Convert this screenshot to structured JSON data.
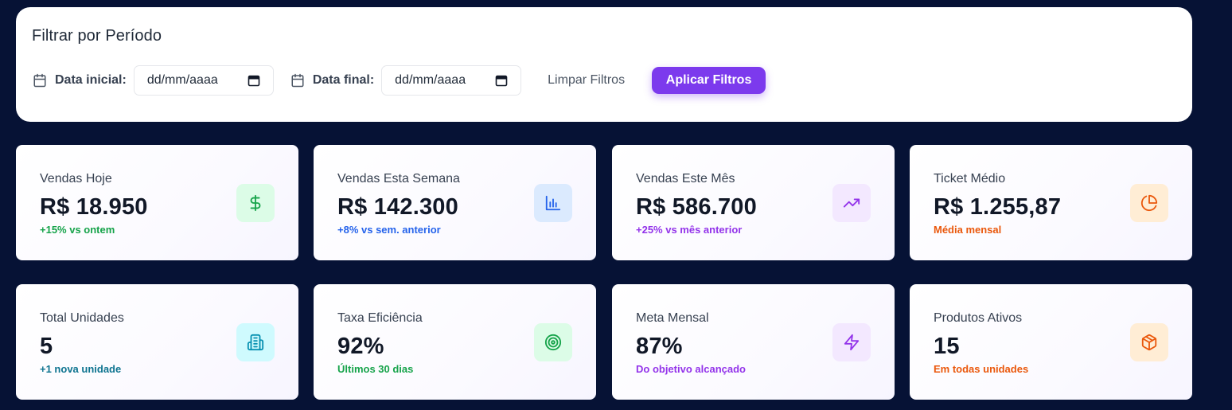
{
  "filter": {
    "title": "Filtrar por Período",
    "start_label": "Data inicial:",
    "start_placeholder": "dd/mm/aaaa",
    "end_label": "Data final:",
    "end_placeholder": "dd/mm/aaaa",
    "clear_label": "Limpar Filtros",
    "apply_label": "Aplicar Filtros"
  },
  "colors": {
    "accent": "#7c3aed",
    "background": "#061235",
    "green": "#16a34a",
    "blue": "#2563eb",
    "purple": "#9333ea",
    "orange": "#ea580c",
    "cyan": "#0e7490"
  },
  "cards": [
    {
      "label": "Vendas Hoje",
      "value": "R$ 18.950",
      "sub": "+15% vs ontem",
      "icon": "dollar-icon",
      "tone": "green"
    },
    {
      "label": "Vendas Esta Semana",
      "value": "R$ 142.300",
      "sub": "+8% vs sem. anterior",
      "icon": "bar-chart-icon",
      "tone": "blue"
    },
    {
      "label": "Vendas Este Mês",
      "value": "R$ 586.700",
      "sub": "+25% vs mês anterior",
      "icon": "trending-up-icon",
      "tone": "purple"
    },
    {
      "label": "Ticket Médio",
      "value": "R$ 1.255,87",
      "sub": "Média mensal",
      "icon": "pie-chart-icon",
      "tone": "orange"
    },
    {
      "label": "Total Unidades",
      "value": "5",
      "sub": "+1 nova unidade",
      "icon": "building-icon",
      "tone": "cyan"
    },
    {
      "label": "Taxa Eficiência",
      "value": "92%",
      "sub": "Últimos 30 dias",
      "icon": "target-icon",
      "tone": "green"
    },
    {
      "label": "Meta Mensal",
      "value": "87%",
      "sub": "Do objetivo alcançado",
      "icon": "lightning-icon",
      "tone": "purple"
    },
    {
      "label": "Produtos Ativos",
      "value": "15",
      "sub": "Em todas unidades",
      "icon": "package-icon",
      "tone": "orange"
    }
  ]
}
